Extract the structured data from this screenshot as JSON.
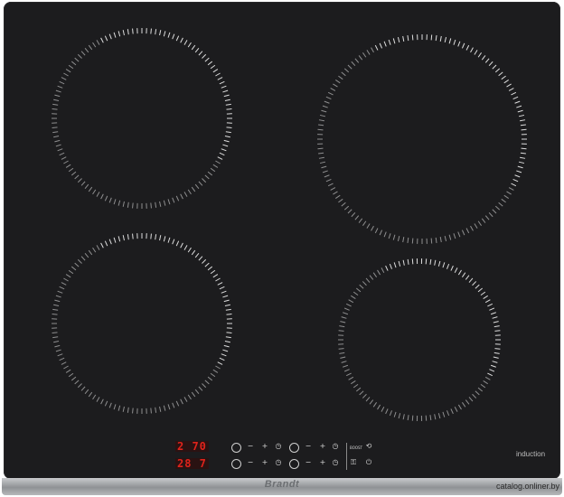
{
  "brand": "Brandt",
  "label": "induction",
  "watermark": "catalog.onliner.by",
  "displays": [
    {
      "digits": "2 70"
    },
    {
      "digits": "28 7"
    }
  ],
  "controls": {
    "minus": "−",
    "plus": "+",
    "timer": "◷",
    "boost": "BOOST",
    "pause": "⟲",
    "lock": "⚿",
    "power": "⏻"
  },
  "colors": {
    "glass": "#1c1c1e",
    "display": "#e0231b",
    "markings": "#ffffff"
  },
  "zones": [
    {
      "id": "front-left-top",
      "name": "rear-left-zone"
    },
    {
      "id": "rear-right",
      "name": "rear-right-zone"
    },
    {
      "id": "front-left",
      "name": "front-left-zone"
    },
    {
      "id": "front-right",
      "name": "front-right-zone"
    }
  ]
}
